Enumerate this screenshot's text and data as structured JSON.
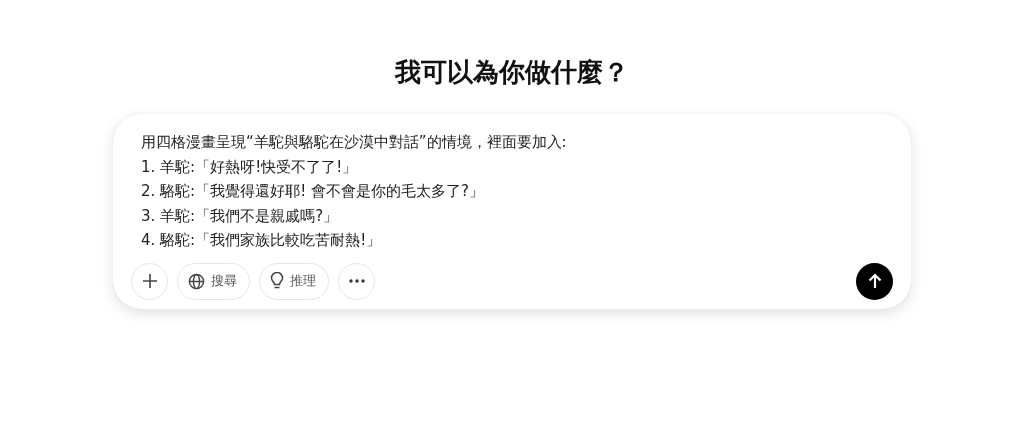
{
  "heading": "我可以為你做什麼？",
  "composer": {
    "value": "用四格漫畫呈現“羊駝與駱駝在沙漠中對話”的情境，裡面要加入:\n1. 羊駝:「好熱呀!快受不了了!」\n2. 駱駝:「我覺得還好耶! 會不會是你的毛太多了?」\n3. 羊駝:「我們不是親戚嗎?」\n4. 駱駝:「我們家族比較吃苦耐熱!」",
    "tools": [
      {
        "kind": "plus"
      },
      {
        "kind": "globe",
        "label": "搜尋"
      },
      {
        "kind": "bulb",
        "label": "推理"
      },
      {
        "kind": "more"
      }
    ]
  }
}
